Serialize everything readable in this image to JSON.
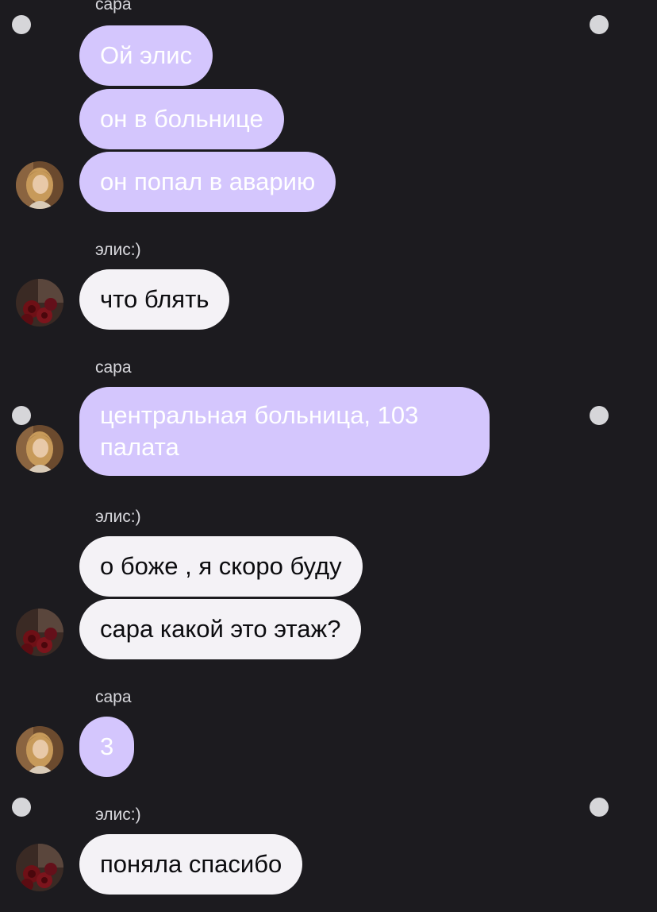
{
  "contacts": {
    "sara": "сара",
    "elis": "элис:)"
  },
  "colors": {
    "background": "#1c1b1f",
    "sara_bubble": "#d4c6fd",
    "elis_bubble": "#f4f2f6"
  },
  "messages": [
    {
      "sender": "sara",
      "text": "Ой элис"
    },
    {
      "sender": "sara",
      "text": "он в больнице"
    },
    {
      "sender": "sara",
      "text": "он попал в аварию"
    },
    {
      "sender": "elis",
      "text": "что блять"
    },
    {
      "sender": "sara",
      "text": "центральная больница, 103 палата"
    },
    {
      "sender": "elis",
      "text": "о боже , я скоро буду"
    },
    {
      "sender": "elis",
      "text": "сара какой это этаж?"
    },
    {
      "sender": "sara",
      "text": "3"
    },
    {
      "sender": "elis",
      "text": "поняла спасибо"
    }
  ],
  "avatars": {
    "sara": "portrait-photo",
    "elis": "roses-photo"
  }
}
